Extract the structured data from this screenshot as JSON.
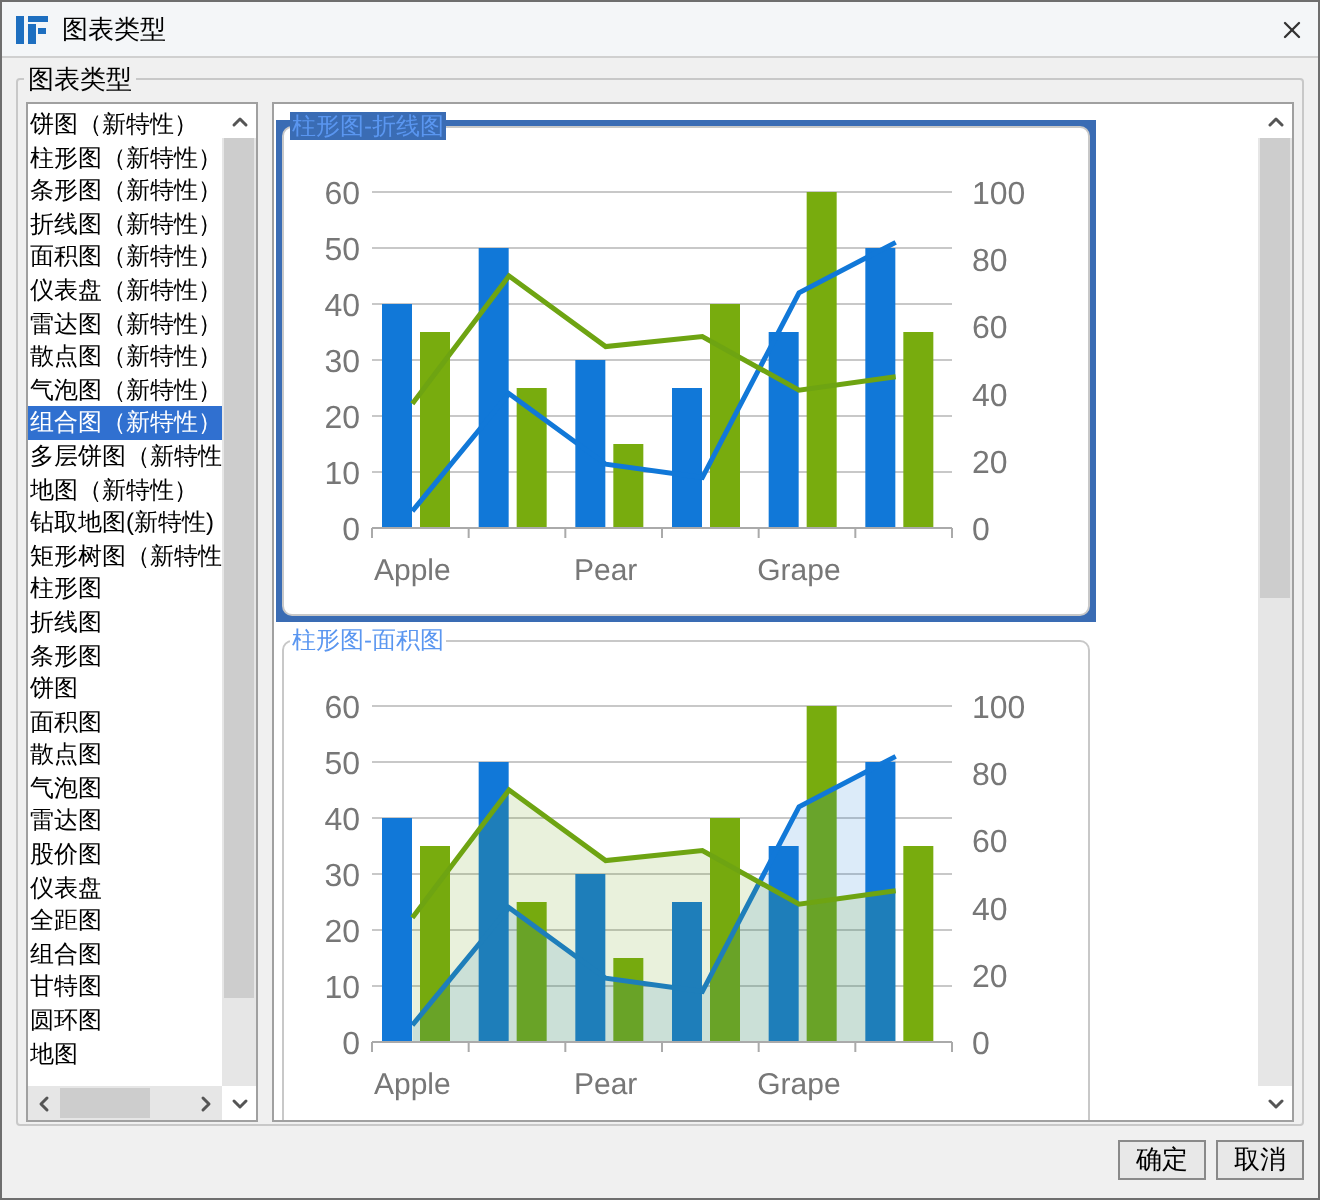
{
  "window": {
    "title": "图表类型"
  },
  "group": {
    "title": "图表类型"
  },
  "types": [
    {
      "label": "饼图（新特性）",
      "selected": false
    },
    {
      "label": "柱形图（新特性）",
      "selected": false
    },
    {
      "label": "条形图（新特性）",
      "selected": false
    },
    {
      "label": "折线图（新特性）",
      "selected": false
    },
    {
      "label": "面积图（新特性）",
      "selected": false
    },
    {
      "label": "仪表盘（新特性）",
      "selected": false
    },
    {
      "label": "雷达图（新特性）",
      "selected": false
    },
    {
      "label": "散点图（新特性）",
      "selected": false
    },
    {
      "label": "气泡图（新特性）",
      "selected": false
    },
    {
      "label": "组合图（新特性）",
      "selected": true
    },
    {
      "label": "多层饼图（新特性",
      "selected": false
    },
    {
      "label": "地图（新特性）",
      "selected": false
    },
    {
      "label": "钻取地图(新特性)",
      "selected": false
    },
    {
      "label": "矩形树图（新特性",
      "selected": false
    },
    {
      "label": "柱形图",
      "selected": false
    },
    {
      "label": "折线图",
      "selected": false
    },
    {
      "label": "条形图",
      "selected": false
    },
    {
      "label": "饼图",
      "selected": false
    },
    {
      "label": "面积图",
      "selected": false
    },
    {
      "label": "散点图",
      "selected": false
    },
    {
      "label": "气泡图",
      "selected": false
    },
    {
      "label": "雷达图",
      "selected": false
    },
    {
      "label": "股价图",
      "selected": false
    },
    {
      "label": "仪表盘",
      "selected": false
    },
    {
      "label": "全距图",
      "selected": false
    },
    {
      "label": "组合图",
      "selected": false
    },
    {
      "label": "甘特图",
      "selected": false
    },
    {
      "label": "圆环图",
      "selected": false
    },
    {
      "label": "地图",
      "selected": false
    }
  ],
  "previews": [
    {
      "title": "柱形图-折线图",
      "selected": true,
      "chart_data": {
        "type": "bar",
        "categories": [
          "Apple",
          null,
          "Pear",
          null,
          "Grape",
          null
        ],
        "grid": true,
        "ylim": [
          0,
          60
        ],
        "yticks": [
          0,
          10,
          20,
          30,
          40,
          50,
          60
        ],
        "y2lim": [
          0,
          100
        ],
        "y2ticks": [
          0,
          20,
          40,
          60,
          80,
          100
        ],
        "series": [
          {
            "type": "bar",
            "color": "#1178d8",
            "values": [
              40,
              50,
              30,
              25,
              35,
              50
            ]
          },
          {
            "type": "bar",
            "color": "#78ac0e",
            "values": [
              35,
              25,
              15,
              40,
              60,
              35
            ]
          },
          {
            "type": "line",
            "axis": "y2",
            "color": "#1178d8",
            "values": [
              5,
              40,
              19,
              15,
              70,
              85
            ]
          },
          {
            "type": "line",
            "axis": "y2",
            "color": "#6ea412",
            "values": [
              37,
              75,
              54,
              57,
              41,
              45
            ]
          }
        ]
      }
    },
    {
      "title": "柱形图-面积图",
      "selected": false,
      "chart_data": {
        "type": "bar",
        "categories": [
          "Apple",
          null,
          "Pear",
          null,
          "Grape",
          null
        ],
        "grid": true,
        "ylim": [
          0,
          60
        ],
        "yticks": [
          0,
          10,
          20,
          30,
          40,
          50,
          60
        ],
        "y2lim": [
          0,
          100
        ],
        "y2ticks": [
          0,
          20,
          40,
          60,
          80,
          100
        ],
        "series": [
          {
            "type": "bar",
            "color": "#1178d8",
            "values": [
              40,
              50,
              30,
              25,
              35,
              50
            ]
          },
          {
            "type": "bar",
            "color": "#78ac0e",
            "values": [
              35,
              25,
              15,
              40,
              60,
              35
            ]
          },
          {
            "type": "area",
            "axis": "y2",
            "color": "#1178d8",
            "values": [
              5,
              40,
              19,
              15,
              70,
              85
            ]
          },
          {
            "type": "area",
            "axis": "y2",
            "color": "#6ea412",
            "values": [
              37,
              75,
              54,
              57,
              41,
              45
            ]
          }
        ]
      }
    }
  ],
  "buttons": [
    {
      "label": "确定"
    },
    {
      "label": "取消"
    }
  ]
}
